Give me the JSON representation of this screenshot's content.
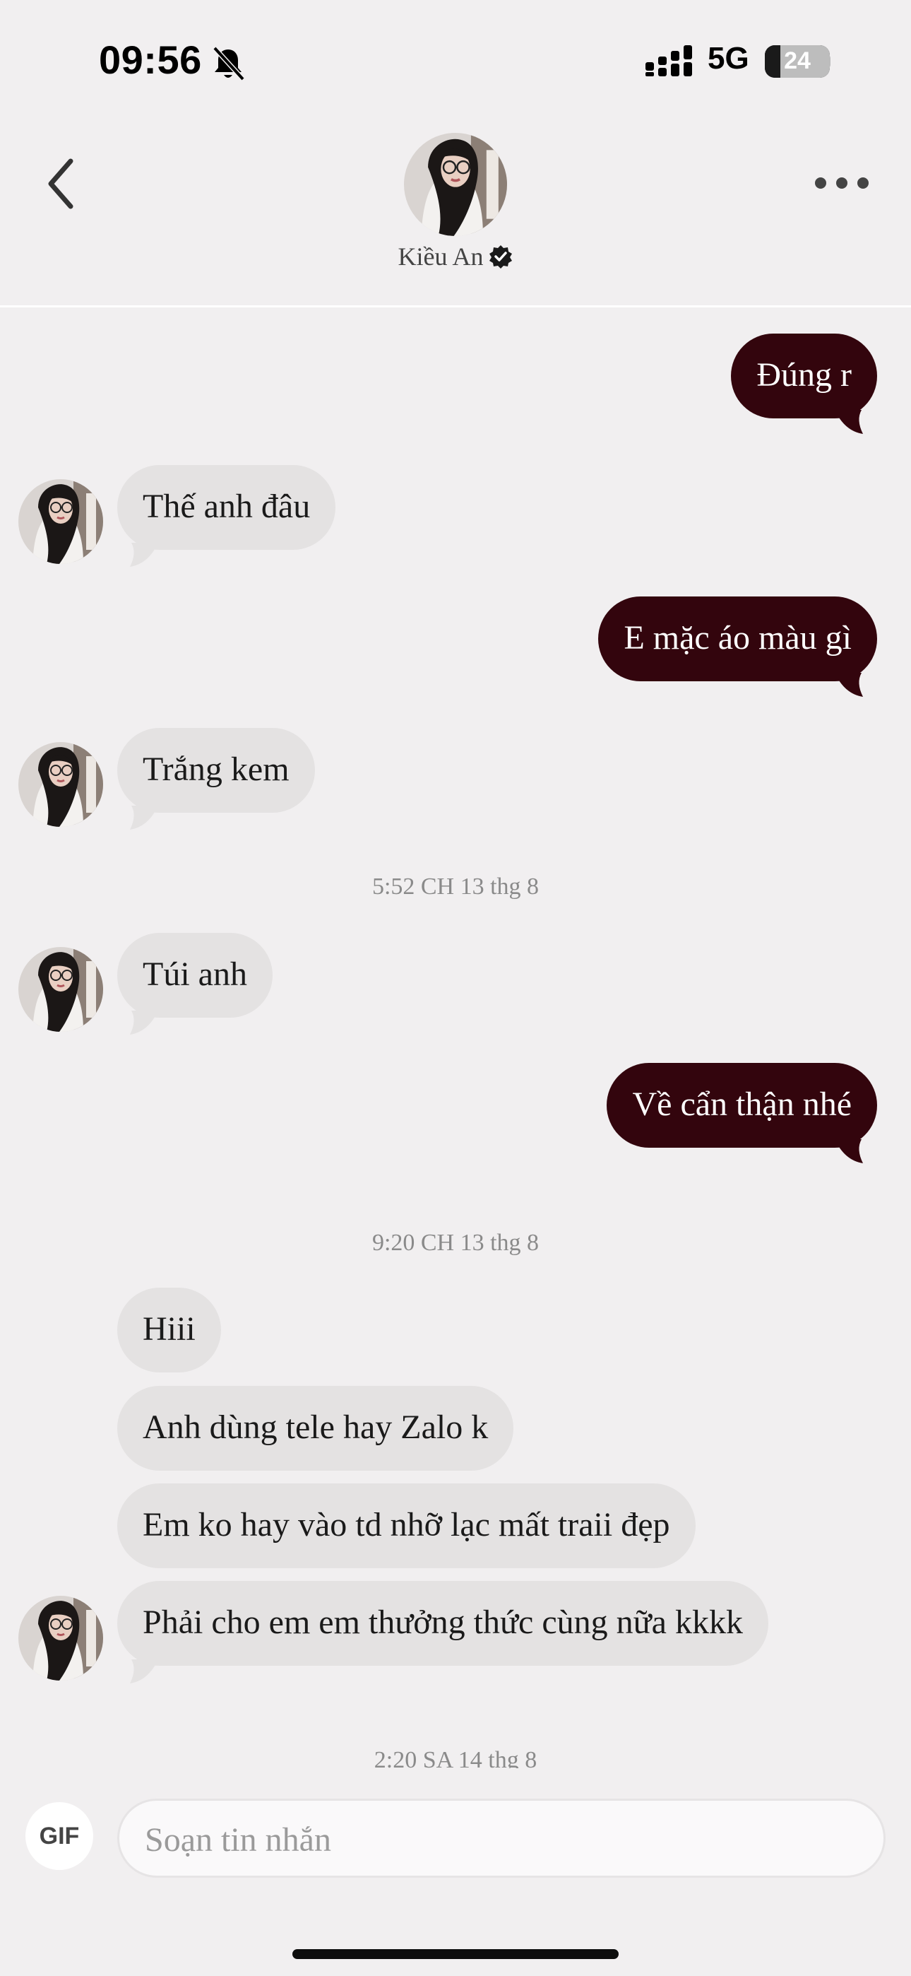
{
  "status_bar": {
    "time": "09:56",
    "network": "5G",
    "battery_level": "24"
  },
  "header": {
    "contact_name": "Kiều An"
  },
  "messages": {
    "m1": "Đúng r",
    "m2": "Thế anh đâu",
    "m3": "E mặc áo màu gì",
    "m4": "Trắng kem",
    "ts1": "5:52 CH 13 thg 8",
    "m5": "Túi anh",
    "m6": "Về cẩn thận nhé",
    "ts2": "9:20 CH 13 thg 8",
    "m7": "Hiii",
    "m8": "Anh dùng tele hay Zalo k",
    "m9": "Em ko hay vào td nhỡ lạc mất traii đẹp",
    "m10": "Phải cho em em thưởng thức cùng nữa kkkk",
    "ts3": "2:20 SA 14 thg 8"
  },
  "composer": {
    "gif_label": "GIF",
    "placeholder": "Soạn tin nhắn"
  },
  "colors": {
    "outgoing_bubble": "#33050d",
    "incoming_bubble": "#e4e2e2",
    "background": "#f1eff0"
  }
}
